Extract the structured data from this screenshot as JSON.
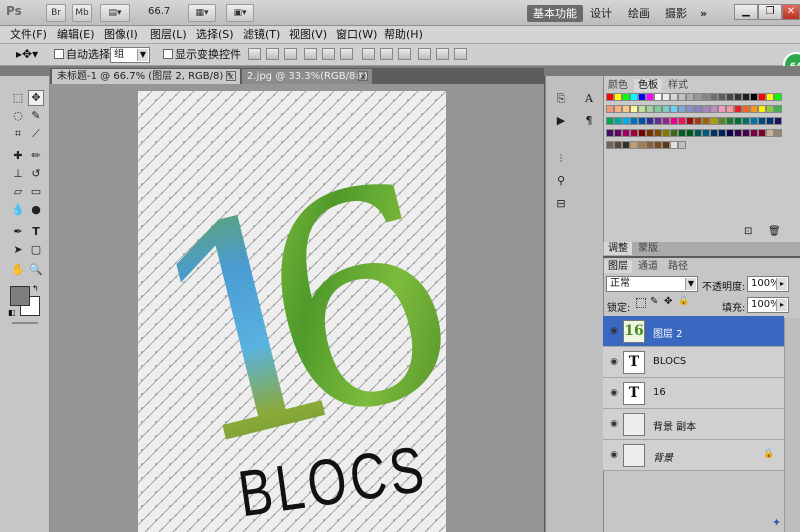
{
  "app": {
    "logo": "Ps",
    "zoom": "66.7",
    "br": "Br",
    "mb": "Mb"
  },
  "workspace": {
    "essentials": "基本功能",
    "design": "设计",
    "painting": "绘画",
    "photography": "摄影",
    "more": "»"
  },
  "menu": [
    "文件(F)",
    "编辑(E)",
    "图像(I)",
    "图层(L)",
    "选择(S)",
    "滤镜(T)",
    "视图(V)",
    "窗口(W)",
    "帮助(H)"
  ],
  "options": {
    "auto_select": "自动选择:",
    "auto_select_value": "组",
    "show_transform": "显示变换控件"
  },
  "tabs": [
    {
      "label": "未标题-1 @ 66.7% (图层 2, RGB/8) *"
    },
    {
      "label": "2.jpg @ 33.3%(RGB/8#)"
    }
  ],
  "canvas": {
    "big_text": "16",
    "sub_text": "BLOCS"
  },
  "swatches_panel": {
    "tab_color": "颜色",
    "tab_swatches": "色板",
    "tab_styles": "样式"
  },
  "adjust_panel": {
    "tab_adjust": "调整",
    "tab_mask": "蒙版"
  },
  "layers_panel": {
    "tab_layers": "图层",
    "tab_channels": "通道",
    "tab_paths": "路径",
    "blend_mode": "正常",
    "opacity_label": "不透明度:",
    "opacity": "100%",
    "lock_label": "锁定:",
    "fill_label": "填充:",
    "fill": "100%",
    "layers": [
      {
        "name": "图层 2",
        "selected": true
      },
      {
        "name": "BLOCS",
        "selected": false
      },
      {
        "name": "16",
        "selected": false
      },
      {
        "name": "背景 副本",
        "selected": false
      },
      {
        "name": "背景",
        "selected": false
      }
    ]
  },
  "badge": "64",
  "colors": {
    "selection": "#3a67bf",
    "green": "#5aa02c"
  }
}
